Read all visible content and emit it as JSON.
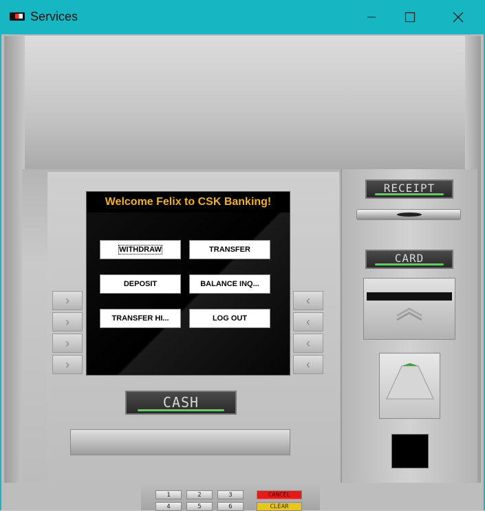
{
  "window": {
    "title": "Services",
    "controls": [
      "minimize",
      "maximize",
      "close"
    ]
  },
  "screen": {
    "welcome": "Welcome Felix to CSK Banking!",
    "buttons": {
      "withdraw": "WITHDRAW",
      "transfer": "TRANSFER",
      "deposit": "DEPOSIT",
      "balance": "BALANCE INQ...",
      "history": "TRANSFER HI...",
      "logout": "LOG OUT"
    }
  },
  "side_keys": {
    "left": [
      "›",
      "›",
      "›",
      "›"
    ],
    "right": [
      "‹",
      "‹",
      "‹",
      "‹"
    ]
  },
  "labels": {
    "cash": "CASH",
    "receipt": "RECEIPT",
    "card": "CARD"
  },
  "keypad": {
    "row1": [
      "1",
      "2",
      "3"
    ],
    "row2": [
      "4",
      "5",
      "6"
    ],
    "cancel": "CANCEL",
    "clear": "CLEAR"
  },
  "colors": {
    "titlebar": "#16b7c3",
    "welcome_text": "#f3b21b",
    "indicator": "#44e044",
    "cancel": "#e21b1b",
    "clear": "#e8c61a"
  }
}
